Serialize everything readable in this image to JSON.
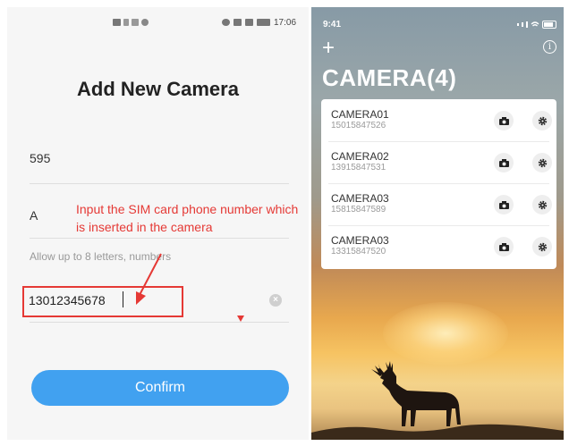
{
  "left_screen": {
    "status_time": "17:06",
    "title": "Add New Camera",
    "field_1_value": "595",
    "field_2_value": "A",
    "hint": "Allow up to 8 letters, numbers",
    "phone_value": "13012345678",
    "confirm_label": "Confirm",
    "annotation": "Input the SIM card phone number which is inserted in the camera"
  },
  "right_screen": {
    "status_time": "9:41",
    "title": "CAMERA(4)",
    "cameras": [
      {
        "name": "CAMERA01",
        "phone": "15015847526"
      },
      {
        "name": "CAMERA02",
        "phone": "13915847531"
      },
      {
        "name": "CAMERA03",
        "phone": "15815847589"
      },
      {
        "name": "CAMERA03",
        "phone": "13315847520"
      }
    ]
  },
  "icons": {
    "add": "plus-icon",
    "info": "info-icon",
    "snapshot": "camera-icon",
    "settings": "gear-icon",
    "clear": "clear-icon"
  },
  "colors": {
    "accent": "#41a1f0",
    "annotation": "#e53935"
  }
}
